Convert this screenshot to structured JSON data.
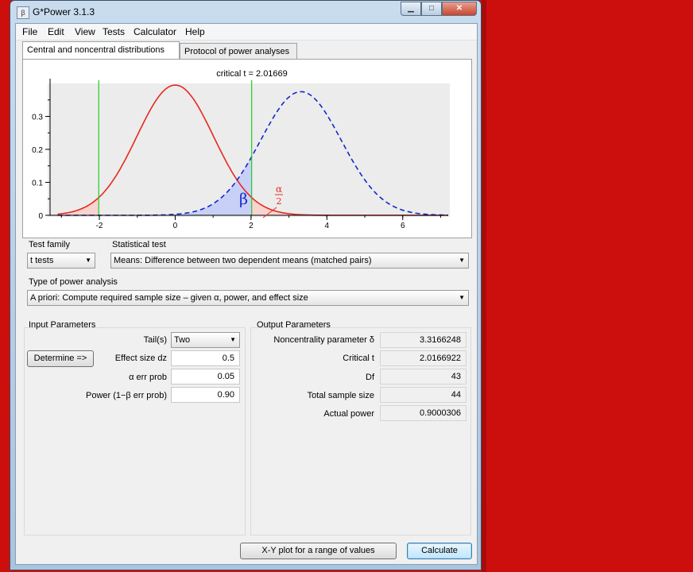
{
  "window": {
    "title": "G*Power 3.1.3",
    "icon": "app-icon",
    "controls": [
      "minimize-icon",
      "maximize-icon",
      "close-icon"
    ]
  },
  "menu": [
    "File",
    "Edit",
    "View",
    "Tests",
    "Calculator",
    "Help"
  ],
  "tabs": [
    "Central and noncentral distributions",
    "Protocol of power analyses"
  ],
  "plot": {
    "header": "critical t = 2.01669",
    "beta_label": "β",
    "alpha_label": "α",
    "alpha_denominator": "2",
    "colors": {
      "central": "#e8281e",
      "noncentral": "#1428c8",
      "critical": "#22cc22",
      "beta_fill": "#c8d0f8",
      "alpha_fill": "#f8d4d0"
    }
  },
  "chart_data": {
    "type": "line",
    "title": "critical t = 2.01669",
    "xlim": [
      -3.3,
      7.2
    ],
    "ylim": [
      0,
      0.4
    ],
    "x_ticks": [
      "-2",
      "0",
      "2",
      "4",
      "6"
    ],
    "x_tick_values": [
      -2,
      0,
      2,
      4,
      6
    ],
    "y_ticks": [
      "0",
      "0.1",
      "0.2",
      "0.3"
    ],
    "y_tick_values": [
      0,
      0.1,
      0.2,
      0.3
    ],
    "series": [
      {
        "style": "solid",
        "color": "#e8281e",
        "distribution": "central t",
        "df": 43,
        "mean": 0,
        "peak": 0.395
      },
      {
        "style": "dashed",
        "color": "#1428c8",
        "distribution": "noncentral t",
        "df": 43,
        "mean": 3.3166248,
        "peak": 0.375
      }
    ],
    "critical_values": [
      -2.01669,
      2.01669
    ],
    "grid": false,
    "legend": "none"
  },
  "test_family": {
    "label": "Test family",
    "value": "t tests"
  },
  "statistical_test": {
    "label": "Statistical test",
    "value": "Means: Difference between two dependent means (matched pairs)"
  },
  "power_analysis": {
    "label": "Type of power analysis",
    "value": "A priori: Compute required sample size – given α, power, and effect size"
  },
  "input": {
    "header": "Input Parameters",
    "determine_button": "Determine =>",
    "tails_label": "Tail(s)",
    "tails_value": "Two",
    "effect_label": "Effect size dz",
    "effect_value": "0.5",
    "alpha_label": "α err prob",
    "alpha_value": "0.05",
    "power_label": "Power (1−β err prob)",
    "power_value": "0.90"
  },
  "output": {
    "header": "Output Parameters",
    "rows": [
      {
        "label": "Noncentrality parameter δ",
        "value": "3.3166248"
      },
      {
        "label": "Critical t",
        "value": "2.0166922"
      },
      {
        "label": "Df",
        "value": "43"
      },
      {
        "label": "Total sample size",
        "value": "44"
      },
      {
        "label": "Actual power",
        "value": "0.9000306"
      }
    ]
  },
  "buttons": {
    "xy_plot": "X-Y plot for a range of values",
    "calculate": "Calculate"
  }
}
